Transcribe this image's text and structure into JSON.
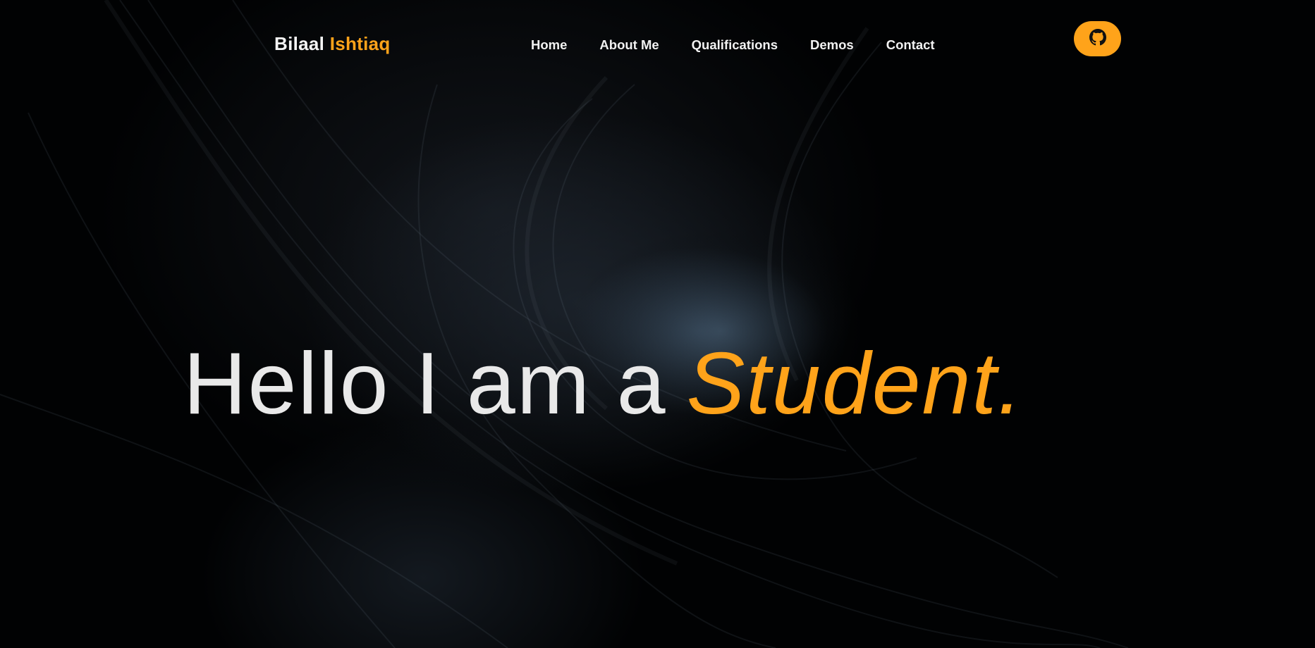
{
  "brand": {
    "first": "Bilaal",
    "last": "Ishtiaq"
  },
  "nav": {
    "items": [
      {
        "label": "Home"
      },
      {
        "label": "About Me"
      },
      {
        "label": "Qualifications"
      },
      {
        "label": "Demos"
      },
      {
        "label": "Contact"
      }
    ],
    "github_icon": "github-icon"
  },
  "hero": {
    "lead": "Hello I am a",
    "role": "Student."
  },
  "colors": {
    "accent": "#ffa31a",
    "text": "#e9e9e9",
    "background": "#010203"
  }
}
